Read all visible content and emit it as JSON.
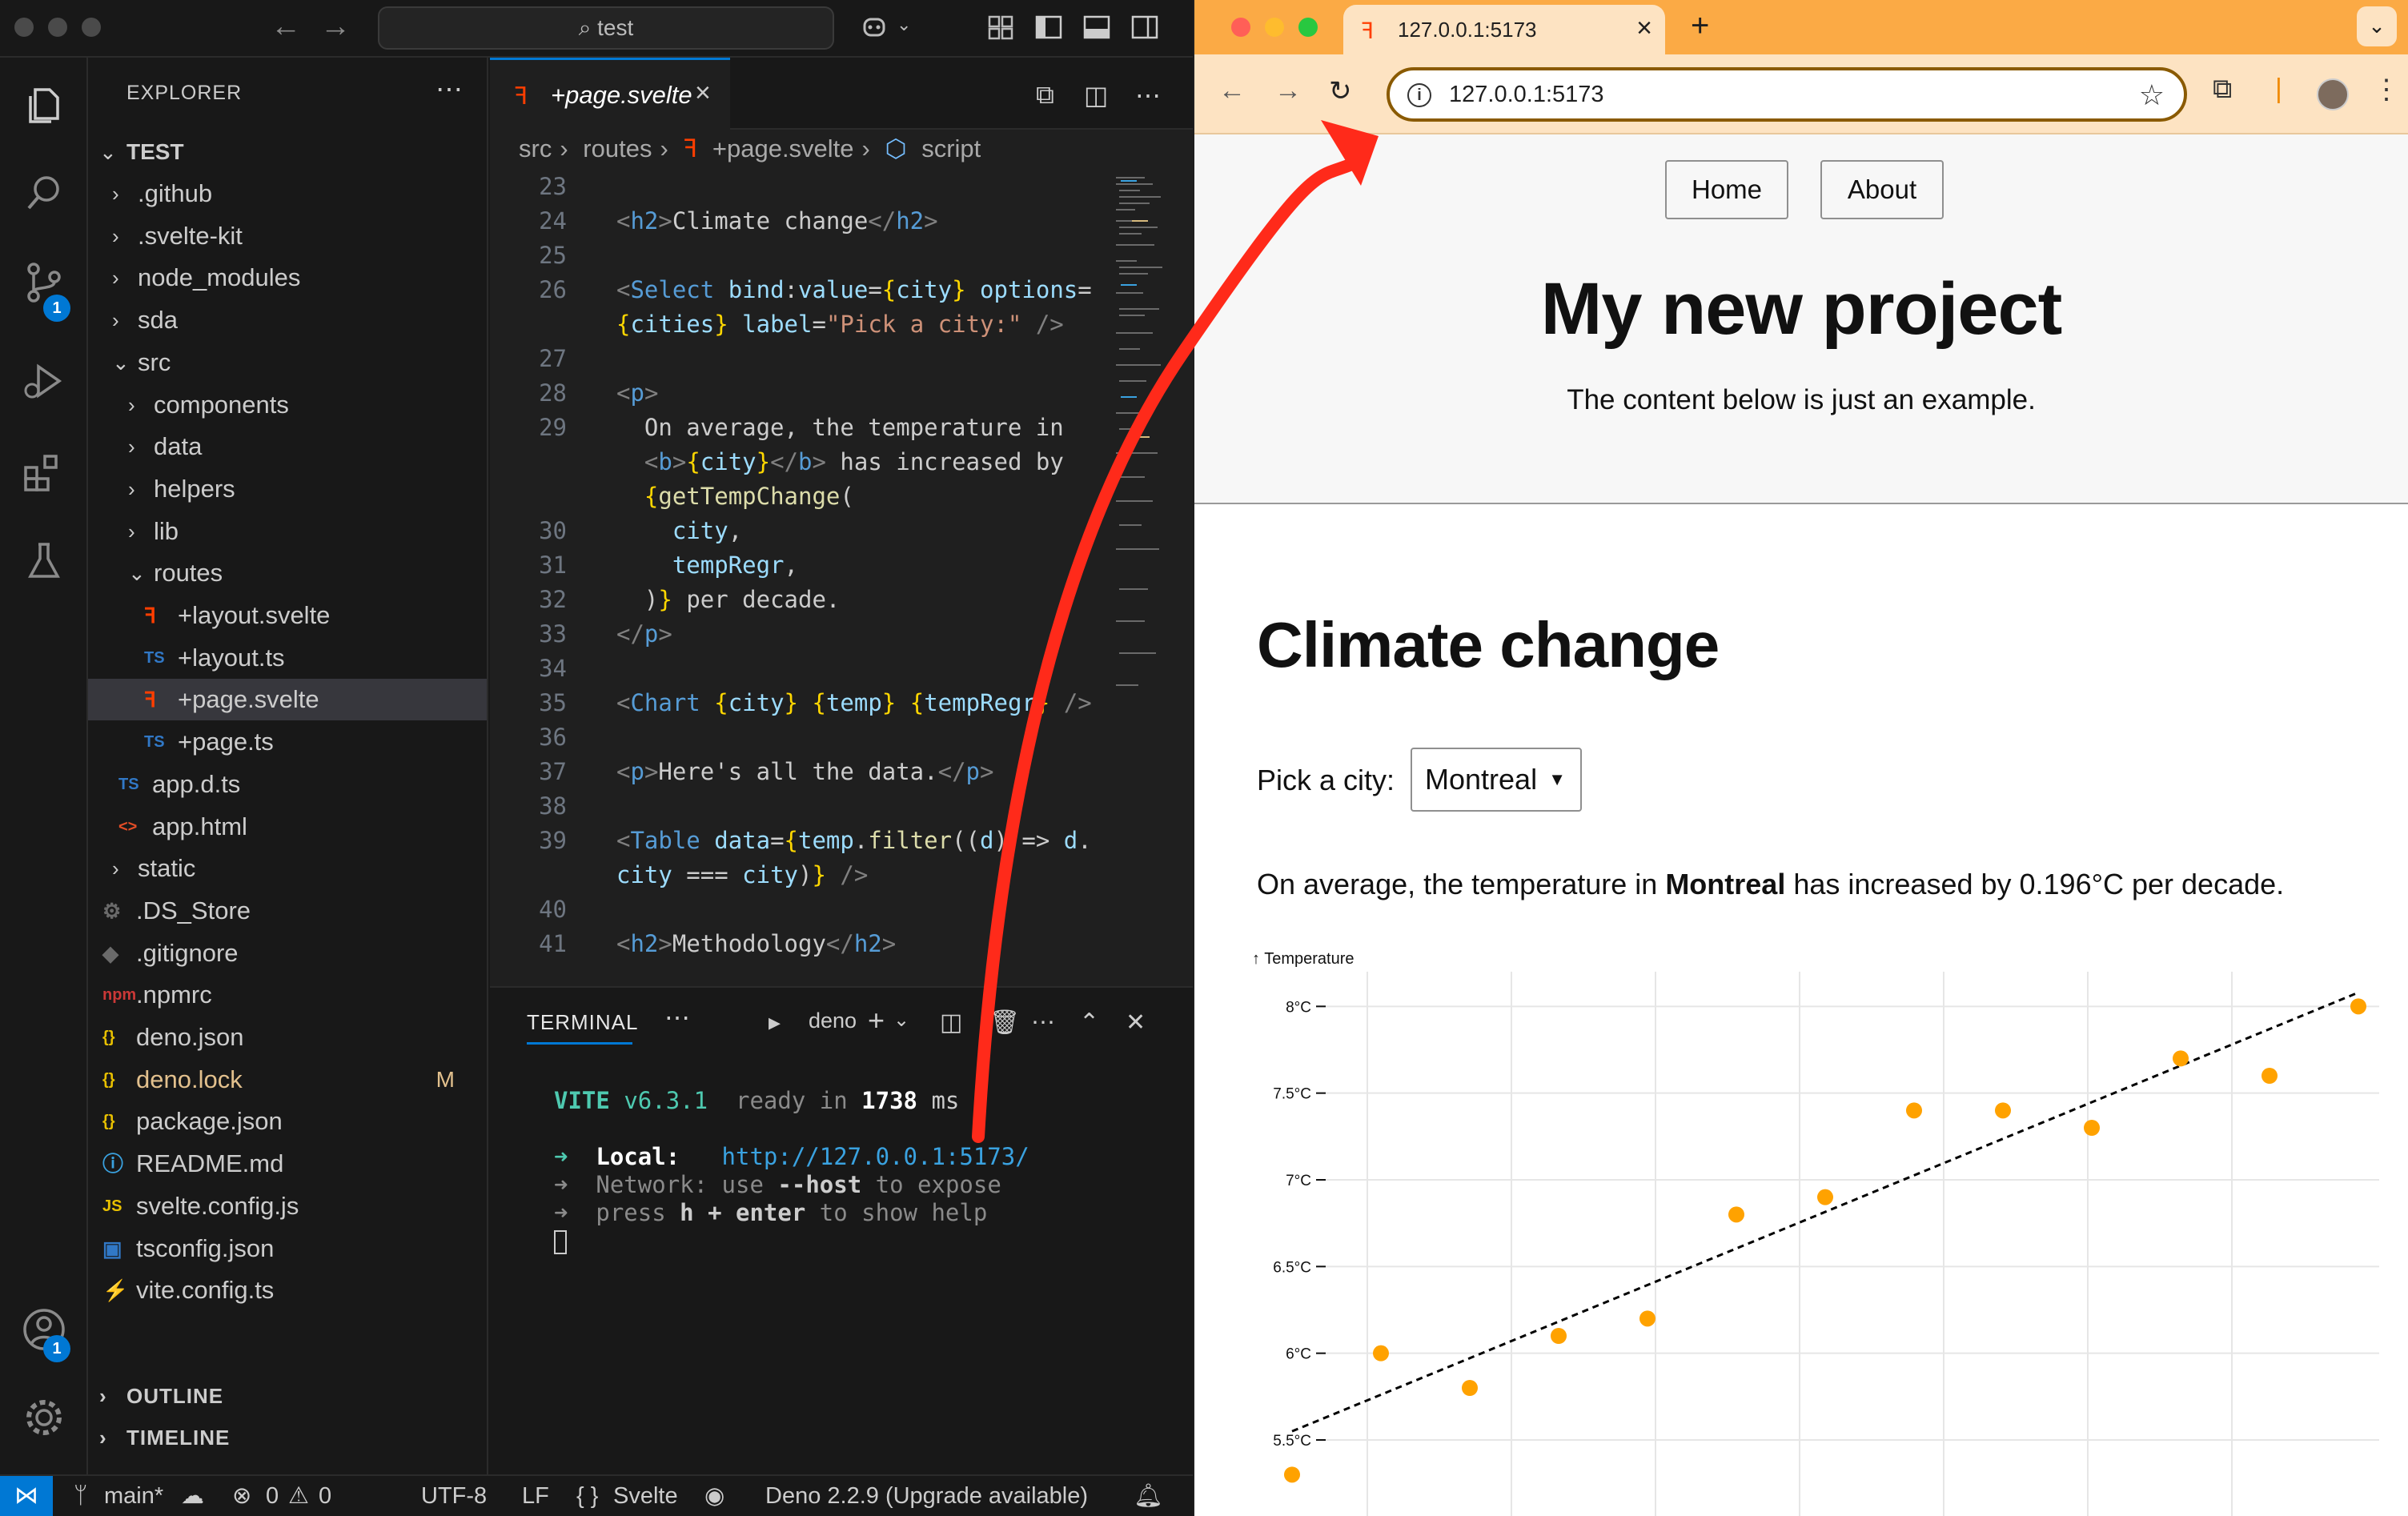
{
  "vscode": {
    "command_center": "test",
    "sidebar": {
      "title": "EXPLORER",
      "folder": "TEST",
      "items": [
        {
          "label": ".github",
          "kind": "folder",
          "depth": 1,
          "open": false
        },
        {
          "label": ".svelte-kit",
          "kind": "folder",
          "depth": 1,
          "open": false
        },
        {
          "label": "node_modules",
          "kind": "folder",
          "depth": 1,
          "open": false
        },
        {
          "label": "sda",
          "kind": "folder",
          "depth": 1,
          "open": false
        },
        {
          "label": "src",
          "kind": "folder",
          "depth": 1,
          "open": true
        },
        {
          "label": "components",
          "kind": "folder",
          "depth": 2,
          "open": false
        },
        {
          "label": "data",
          "kind": "folder",
          "depth": 2,
          "open": false
        },
        {
          "label": "helpers",
          "kind": "folder",
          "depth": 2,
          "open": false
        },
        {
          "label": "lib",
          "kind": "folder",
          "depth": 2,
          "open": false
        },
        {
          "label": "routes",
          "kind": "folder",
          "depth": 2,
          "open": true
        },
        {
          "label": "+layout.svelte",
          "kind": "svelte",
          "depth": 3
        },
        {
          "label": "+layout.ts",
          "kind": "ts",
          "depth": 3
        },
        {
          "label": "+page.svelte",
          "kind": "svelte",
          "depth": 3,
          "selected": true
        },
        {
          "label": "+page.ts",
          "kind": "ts",
          "depth": 3
        },
        {
          "label": "app.d.ts",
          "kind": "ts",
          "depth": 2
        },
        {
          "label": "app.html",
          "kind": "html",
          "depth": 2
        },
        {
          "label": "static",
          "kind": "folder",
          "depth": 1,
          "open": false
        },
        {
          "label": ".DS_Store",
          "kind": "dsstore",
          "depth": 1
        },
        {
          "label": ".gitignore",
          "kind": "git",
          "depth": 1
        },
        {
          "label": ".npmrc",
          "kind": "npm",
          "depth": 1
        },
        {
          "label": "deno.json",
          "kind": "json",
          "depth": 1
        },
        {
          "label": "deno.lock",
          "kind": "json",
          "depth": 1,
          "modified": "M"
        },
        {
          "label": "package.json",
          "kind": "json",
          "depth": 1
        },
        {
          "label": "README.md",
          "kind": "info",
          "depth": 1
        },
        {
          "label": "svelte.config.js",
          "kind": "js",
          "depth": 1
        },
        {
          "label": "tsconfig.json",
          "kind": "tsconfig",
          "depth": 1
        },
        {
          "label": "vite.config.ts",
          "kind": "vite",
          "depth": 1
        }
      ],
      "outline": "OUTLINE",
      "timeline": "TIMELINE"
    },
    "badges": {
      "scm": "1",
      "accounts": "1"
    },
    "tab": {
      "label": "+page.svelte"
    },
    "breadcrumb": [
      "src",
      "routes",
      "+page.svelte",
      "script"
    ],
    "code": [
      {
        "n": "23",
        "segs": []
      },
      {
        "n": "24",
        "segs": [
          [
            "tag",
            "<"
          ],
          [
            "tn",
            "h2"
          ],
          [
            "tag",
            ">"
          ],
          [
            "cm",
            "Climate change"
          ],
          [
            "tag",
            "</"
          ],
          [
            "tn",
            "h2"
          ],
          [
            "tag",
            ">"
          ]
        ]
      },
      {
        "n": "25",
        "segs": []
      },
      {
        "n": "26",
        "segs": [
          [
            "tag",
            "<"
          ],
          [
            "tn",
            "Select "
          ],
          [
            "at",
            "bind"
          ],
          [
            "cm",
            ":"
          ],
          [
            "at",
            "value"
          ],
          [
            "cm",
            "="
          ],
          [
            "br",
            "{"
          ],
          [
            "vr",
            "city"
          ],
          [
            "br",
            "}"
          ],
          [
            "at",
            " options"
          ],
          [
            "cm",
            "="
          ]
        ]
      },
      {
        "n": "",
        "segs": [
          [
            "br",
            "{"
          ],
          [
            "vr",
            "cities"
          ],
          [
            "br",
            "}"
          ],
          [
            "at",
            " label"
          ],
          [
            "cm",
            "="
          ],
          [
            "str",
            "\"Pick a city:\""
          ],
          [
            "tag",
            " />"
          ]
        ]
      },
      {
        "n": "27",
        "segs": []
      },
      {
        "n": "28",
        "segs": [
          [
            "tag",
            "<"
          ],
          [
            "tn",
            "p"
          ],
          [
            "tag",
            ">"
          ]
        ]
      },
      {
        "n": "29",
        "segs": [
          [
            "cm",
            "  On average, the temperature in"
          ]
        ]
      },
      {
        "n": "",
        "segs": [
          [
            "cm",
            "  "
          ],
          [
            "tag",
            "<"
          ],
          [
            "tn",
            "b"
          ],
          [
            "tag",
            ">"
          ],
          [
            "br",
            "{"
          ],
          [
            "vr",
            "city"
          ],
          [
            "br",
            "}"
          ],
          [
            "tag",
            "</"
          ],
          [
            "tn",
            "b"
          ],
          [
            "tag",
            ">"
          ],
          [
            "cm",
            " has increased by"
          ]
        ]
      },
      {
        "n": "",
        "segs": [
          [
            "cm",
            "  "
          ],
          [
            "br",
            "{"
          ],
          [
            "fn",
            "getTempChange"
          ],
          [
            "cm",
            "("
          ]
        ]
      },
      {
        "n": "30",
        "segs": [
          [
            "cm",
            "    "
          ],
          [
            "vr",
            "city"
          ],
          [
            "cm",
            ","
          ]
        ]
      },
      {
        "n": "31",
        "segs": [
          [
            "cm",
            "    "
          ],
          [
            "vr",
            "tempRegr"
          ],
          [
            "cm",
            ","
          ]
        ]
      },
      {
        "n": "32",
        "segs": [
          [
            "cm",
            "  )"
          ],
          [
            "br",
            "}"
          ],
          [
            "cm",
            " per decade."
          ]
        ]
      },
      {
        "n": "33",
        "segs": [
          [
            "tag",
            "</"
          ],
          [
            "tn",
            "p"
          ],
          [
            "tag",
            ">"
          ]
        ]
      },
      {
        "n": "34",
        "segs": []
      },
      {
        "n": "35",
        "segs": [
          [
            "tag",
            "<"
          ],
          [
            "tn",
            "Chart "
          ],
          [
            "br",
            "{"
          ],
          [
            "vr",
            "city"
          ],
          [
            "br",
            "}"
          ],
          [
            "cm",
            " "
          ],
          [
            "br",
            "{"
          ],
          [
            "vr",
            "temp"
          ],
          [
            "br",
            "}"
          ],
          [
            "cm",
            " "
          ],
          [
            "br",
            "{"
          ],
          [
            "vr",
            "tempRegr"
          ],
          [
            "br",
            "}"
          ],
          [
            "tag",
            " />"
          ]
        ]
      },
      {
        "n": "36",
        "segs": []
      },
      {
        "n": "37",
        "segs": [
          [
            "tag",
            "<"
          ],
          [
            "tn",
            "p"
          ],
          [
            "tag",
            ">"
          ],
          [
            "cm",
            "Here's all the data."
          ],
          [
            "tag",
            "</"
          ],
          [
            "tn",
            "p"
          ],
          [
            "tag",
            ">"
          ]
        ]
      },
      {
        "n": "38",
        "segs": []
      },
      {
        "n": "39",
        "segs": [
          [
            "tag",
            "<"
          ],
          [
            "tn",
            "Table "
          ],
          [
            "at",
            "data"
          ],
          [
            "cm",
            "="
          ],
          [
            "br",
            "{"
          ],
          [
            "vr",
            "temp"
          ],
          [
            "cm",
            "."
          ],
          [
            "fn",
            "filter"
          ],
          [
            "cm",
            "(("
          ],
          [
            "vr",
            "d"
          ],
          [
            "cm",
            ") => "
          ],
          [
            "vr",
            "d"
          ],
          [
            "cm",
            "."
          ]
        ]
      },
      {
        "n": "",
        "segs": [
          [
            "vr",
            "city"
          ],
          [
            "cm",
            " === "
          ],
          [
            "vr",
            "city"
          ],
          [
            "cm",
            ")"
          ],
          [
            "br",
            "}"
          ],
          [
            "tag",
            " />"
          ]
        ]
      },
      {
        "n": "40",
        "segs": []
      },
      {
        "n": "41",
        "segs": [
          [
            "tag",
            "<"
          ],
          [
            "tn",
            "h2"
          ],
          [
            "tag",
            ">"
          ],
          [
            "cm",
            "Methodology"
          ],
          [
            "tag",
            "</"
          ],
          [
            "tn",
            "h2"
          ],
          [
            "tag",
            ">"
          ]
        ]
      }
    ],
    "panel": {
      "tab": "TERMINAL",
      "shell": "deno",
      "terminal": {
        "vite": "VITE",
        "version": "v6.3.1",
        "ready": "ready in",
        "ms": "1738",
        "ms_unit": "ms",
        "local_label": "Local:",
        "local_url": "http://127.0.0.1:5173/",
        "network_label": "Network:",
        "network_text1": "use",
        "network_flag": "--host",
        "network_text2": "to expose",
        "help_text1": "press",
        "help_key": "h + enter",
        "help_text2": "to show help"
      }
    },
    "status": {
      "branch": "main*",
      "errors": "0",
      "warnings": "0",
      "encoding": "UTF-8",
      "eol": "LF",
      "language": "Svelte",
      "deno": "Deno 2.2.9 (Upgrade available)"
    }
  },
  "browser": {
    "tab_title": "127.0.0.1:5173",
    "url": "127.0.0.1:5173",
    "nav": {
      "home": "Home",
      "about": "About"
    },
    "title": "My new project",
    "subtitle": "The content below is just an example.",
    "heading": "Climate change",
    "pick_label": "Pick a city:",
    "city": "Montreal",
    "para_prefix": "On average, the temperature in",
    "para_city": "Montreal",
    "para_suffix": "has increased by 0.196°C per decade."
  },
  "chart_data": {
    "type": "scatter",
    "ylabel": "↑ Temperature",
    "y_ticks": [
      "5.5°C",
      "6°C",
      "6.5°C",
      "7°C",
      "7.5°C",
      "8°C"
    ],
    "y_values": [
      5.5,
      6,
      6.5,
      7,
      7.5,
      8
    ],
    "ylim": [
      5.2,
      8.2
    ],
    "grid": true,
    "points": [
      5.3,
      6.0,
      5.8,
      6.1,
      6.2,
      6.8,
      6.9,
      7.4,
      7.4,
      7.3,
      7.7,
      7.6,
      8.0
    ],
    "trend": [
      5.55,
      8.08
    ],
    "colors": {
      "points": "#ffa200",
      "trend": "#000000"
    }
  },
  "colors": {
    "accent": "#0078d4",
    "svelte": "#ff3e00",
    "tabstrip": "#fbaa45",
    "toolbar": "#fde3c2",
    "arrow": "#ff2a1a"
  }
}
